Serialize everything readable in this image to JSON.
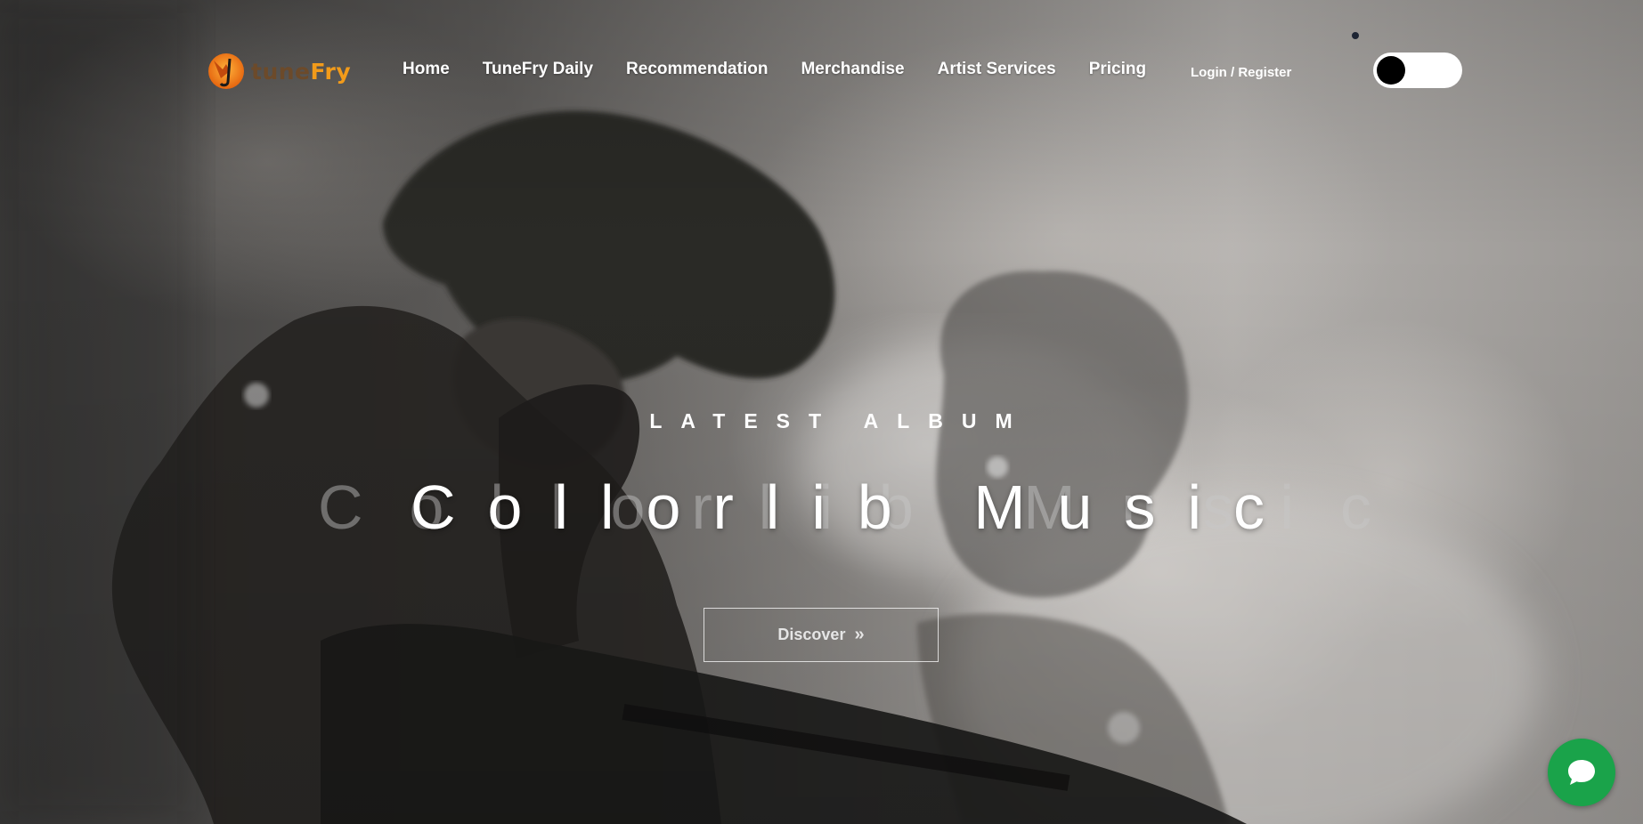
{
  "brand": {
    "logo_alt": "tuneFry",
    "name_part1": "tune",
    "name_part2": "Fry",
    "colors": {
      "part1": "#6c4a2a",
      "part2": "#f29b1a"
    }
  },
  "nav": {
    "items": [
      {
        "label": "Home"
      },
      {
        "label": "TuneFry Daily"
      },
      {
        "label": "Recommendation"
      },
      {
        "label": "Merchandise"
      },
      {
        "label": "Artist Services"
      },
      {
        "label": "Pricing"
      }
    ],
    "login_label": "Login / Register",
    "theme_toggle": {
      "state": "off",
      "icon": "toggle-switch"
    }
  },
  "hero": {
    "eyebrow": "LATEST ALBUM",
    "title": "Collorlib Music",
    "title_shadow": "Collorlib Music",
    "cta_label": "Discover",
    "cta_icon": "double-chevron-right-icon",
    "cta_glyph": "»"
  },
  "chat": {
    "icon": "chat-bubble-icon",
    "color": "#1aa34a"
  }
}
